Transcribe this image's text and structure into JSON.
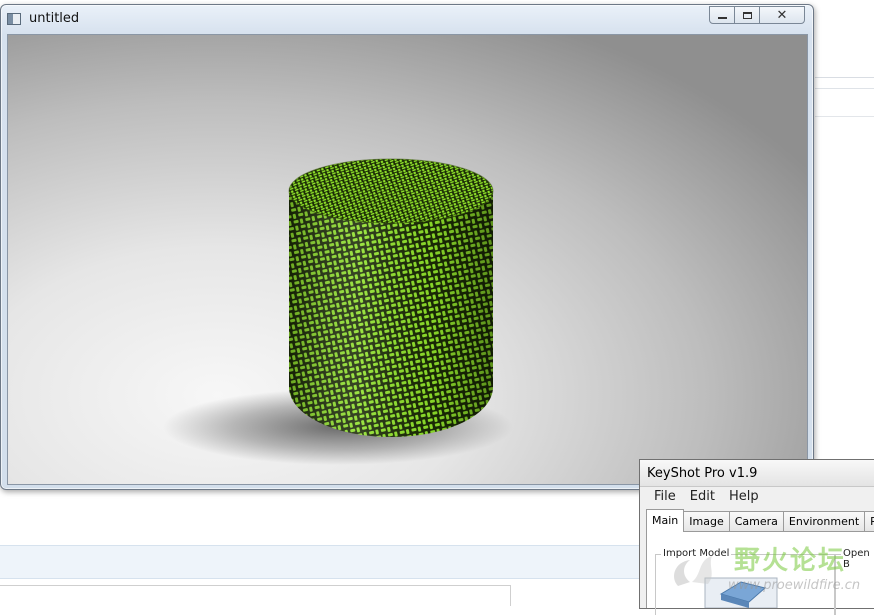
{
  "render_window": {
    "title": "untitled",
    "controls": {
      "minimize": "minimize",
      "maximize": "maximize",
      "close": "close"
    }
  },
  "viewport": {
    "object": "cylinder",
    "texture": "woven-weave",
    "colors": {
      "weave_primary": "#8ee02a",
      "weave_dark": "#1a2a05",
      "backdrop_light": "#f4f4f4",
      "backdrop_dark": "#8a8a8a"
    }
  },
  "keyshot": {
    "title": "KeyShot Pro v1.9",
    "menu": [
      "File",
      "Edit",
      "Help"
    ],
    "tabs": [
      "Main",
      "Image",
      "Camera",
      "Environment",
      "Ren"
    ],
    "active_tab": "Main",
    "groups": {
      "import_model": "Import Model",
      "open": "Open B"
    }
  },
  "watermark": {
    "text": "野火论坛",
    "url": "www.proewildfire.cn"
  }
}
